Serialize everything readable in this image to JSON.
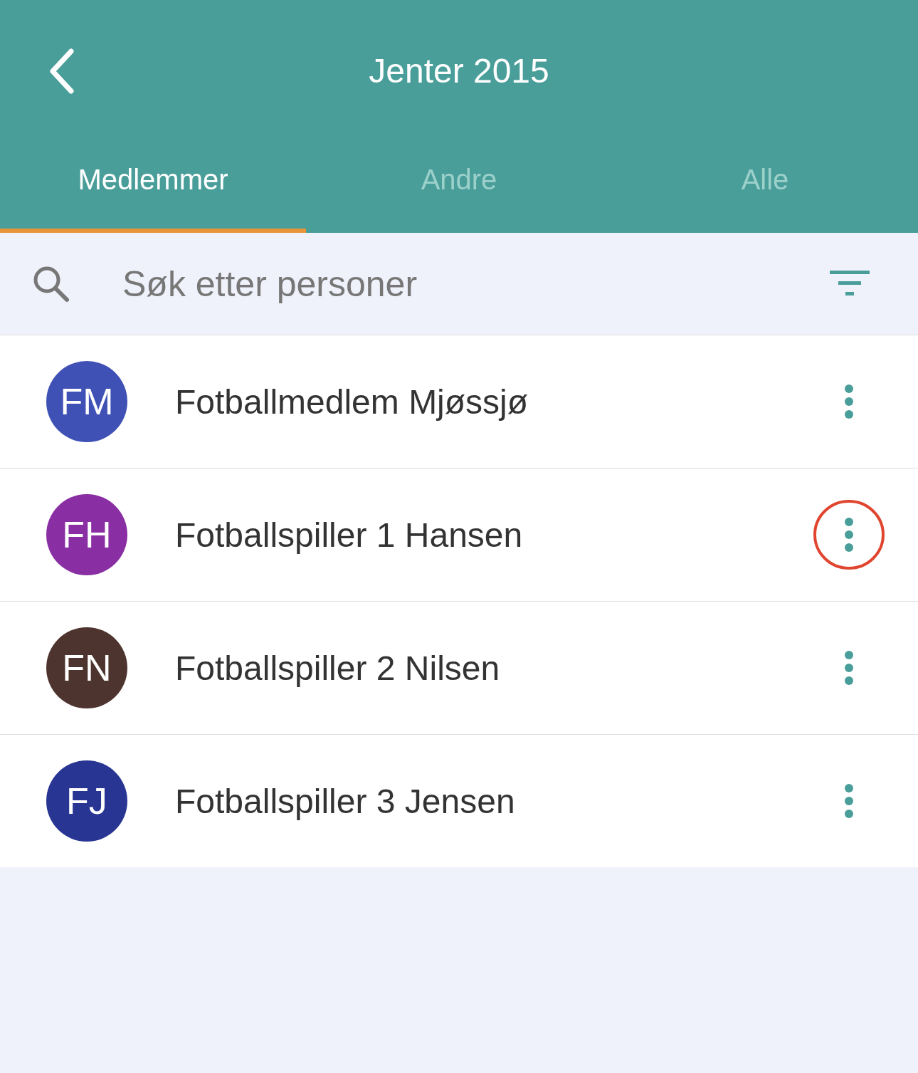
{
  "header": {
    "title": "Jenter 2015"
  },
  "tabs": [
    {
      "label": "Medlemmer",
      "selected": true
    },
    {
      "label": "Andre",
      "selected": false
    },
    {
      "label": "Alle",
      "selected": false
    }
  ],
  "search": {
    "placeholder": "Søk etter personer"
  },
  "members": [
    {
      "initials": "FM",
      "name": "Fotballmedlem Mjøssjø",
      "color": "#3f51b5",
      "highlighted": false
    },
    {
      "initials": "FH",
      "name": "Fotballspiller 1 Hansen",
      "color": "#8a2fa3",
      "highlighted": true
    },
    {
      "initials": "FN",
      "name": "Fotballspiller 2 Nilsen",
      "color": "#4e342e",
      "highlighted": false
    },
    {
      "initials": "FJ",
      "name": "Fotballspiller 3 Jensen",
      "color": "#283593",
      "highlighted": false
    }
  ]
}
